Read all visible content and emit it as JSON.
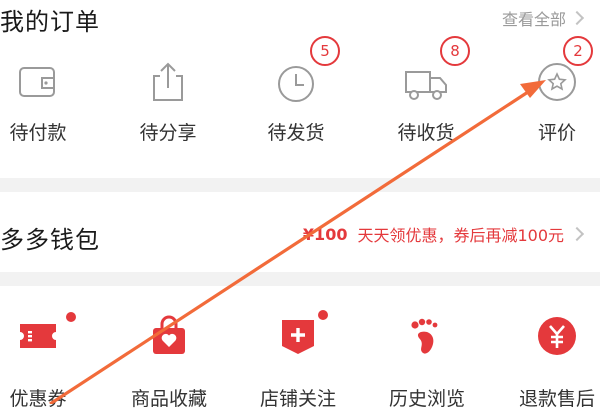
{
  "orders": {
    "title": "我的订单",
    "view_all": "查看全部",
    "items": [
      {
        "label": "待付款",
        "icon": "wallet-icon",
        "badge": ""
      },
      {
        "label": "待分享",
        "icon": "share-icon",
        "badge": ""
      },
      {
        "label": "待发货",
        "icon": "clock-icon",
        "badge": "5"
      },
      {
        "label": "待收货",
        "icon": "truck-icon",
        "badge": "8"
      },
      {
        "label": "评价",
        "icon": "star-bubble-icon",
        "badge": "2"
      }
    ]
  },
  "wallet": {
    "title": "多多钱包",
    "promo_amount": "¥100",
    "promo_text": "天天领优惠，券后再减100元",
    "items": [
      {
        "label": "优惠券",
        "icon": "coupon-icon"
      },
      {
        "label": "商品收藏",
        "icon": "favorites-bag-icon"
      },
      {
        "label": "店铺关注",
        "icon": "store-follow-icon"
      },
      {
        "label": "历史浏览",
        "icon": "footprint-icon"
      },
      {
        "label": "退款售后",
        "icon": "refund-icon"
      }
    ]
  },
  "colors": {
    "accent": "#e4393c",
    "annotation_arrow": "#f26b3a",
    "divider": "#f2f2f2"
  }
}
